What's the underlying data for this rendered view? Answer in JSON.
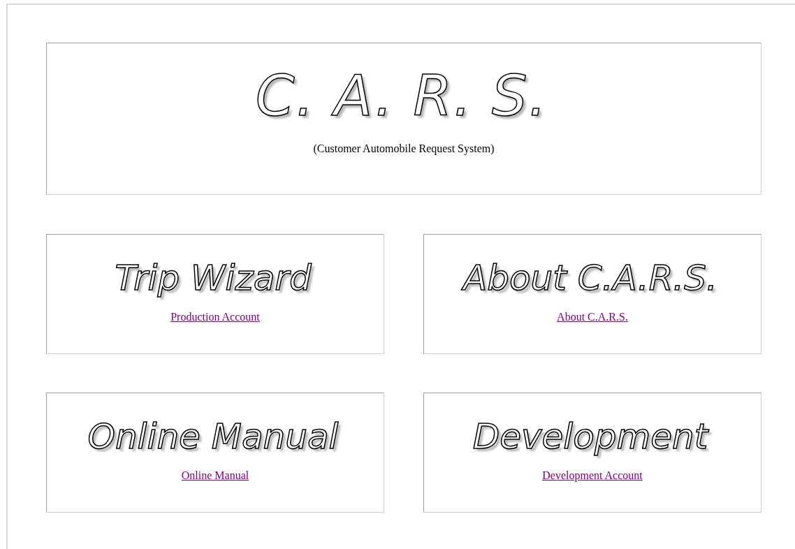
{
  "header": {
    "title": "C. A. R. S.",
    "subtitle": "(Customer Automobile Request System)"
  },
  "cards": [
    {
      "heading": "Trip Wizard",
      "link": "Production Account"
    },
    {
      "heading": "About C.A.R.S.",
      "link": "About C.A.R.S."
    },
    {
      "heading": "Online Manual",
      "link": "Online Manual"
    },
    {
      "heading": "Development",
      "link": "Development Account"
    }
  ]
}
